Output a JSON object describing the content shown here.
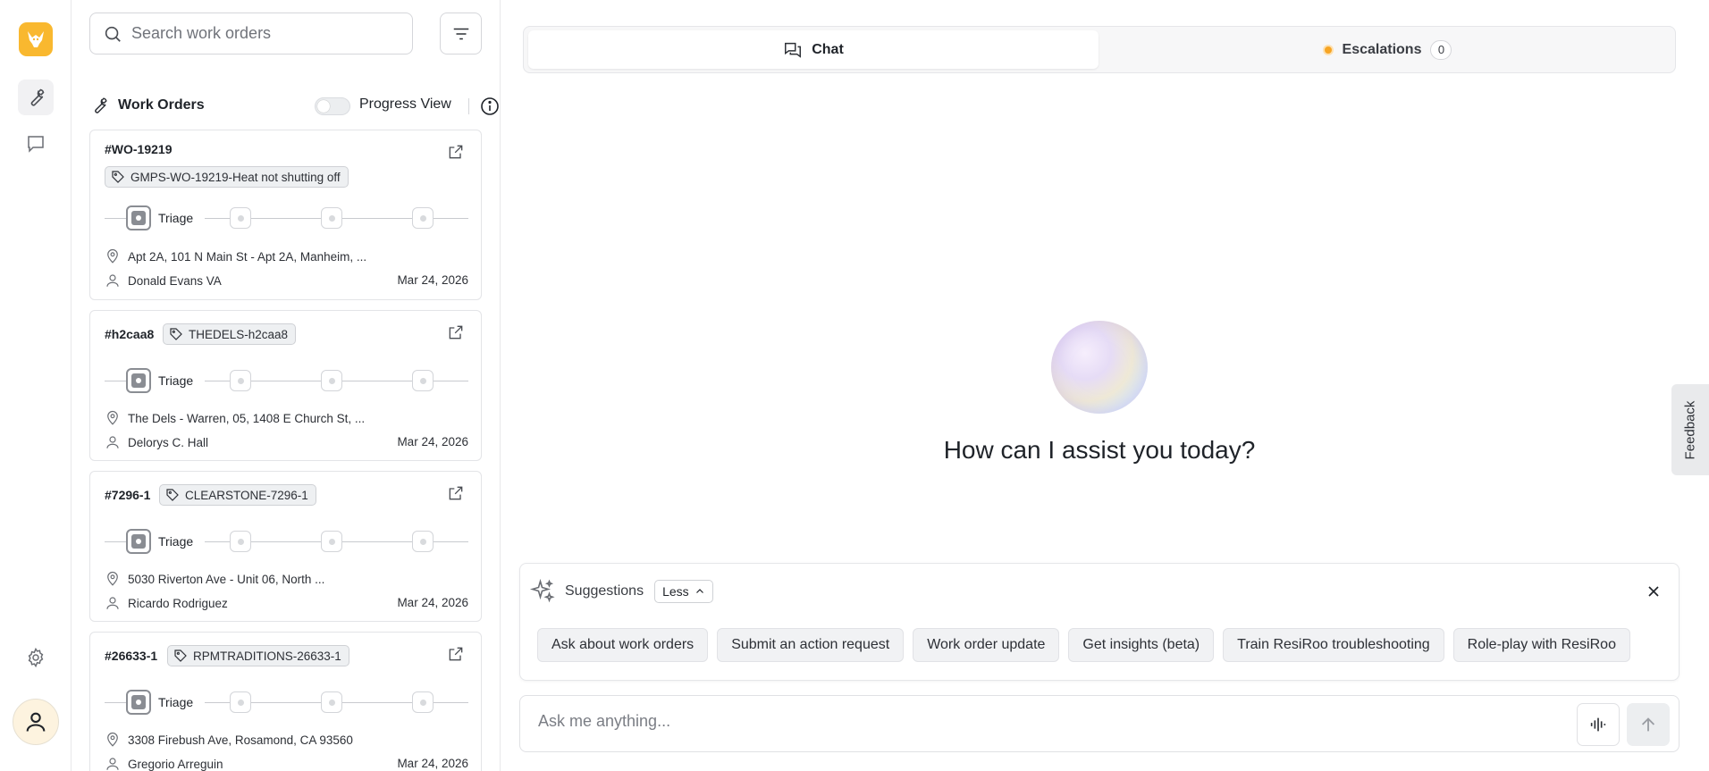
{
  "rail": {
    "logo_color": "#f9b82f",
    "items": [
      {
        "icon": "wrench-icon",
        "active": true
      },
      {
        "icon": "chat-bubble-icon",
        "active": false
      }
    ],
    "settings_icon": "gear-icon",
    "avatar_icon": "user-icon"
  },
  "workorders": {
    "search_placeholder": "Search work orders",
    "header_title": "Work Orders",
    "progress_view_label": "Progress View",
    "progress_view_on": false,
    "cards": [
      {
        "id": "#WO-19219",
        "tag": "GMPS-WO-19219-Heat not shutting off",
        "stage": "Triage",
        "address": "Apt 2A, 101 N Main St - Apt 2A, Manheim, ...",
        "person": "Donald Evans VA",
        "date": "Mar 24, 2026"
      },
      {
        "id": "#h2caa8",
        "tag": "THEDELS-h2caa8",
        "stage": "Triage",
        "address": "The Dels - Warren, 05, 1408 E Church St, ...",
        "person": "Delorys C. Hall",
        "date": "Mar 24, 2026"
      },
      {
        "id": "#7296-1",
        "tag": "CLEARSTONE-7296-1",
        "stage": "Triage",
        "address": "5030 Riverton Ave - Unit 06, North ...",
        "person": "Ricardo Rodriguez",
        "date": "Mar 24, 2026"
      },
      {
        "id": "#26633-1",
        "tag": "RPMTRADITIONS-26633-1",
        "stage": "Triage",
        "address": "3308 Firebush Ave, Rosamond, CA 93560",
        "person": "Gregorio Arreguin",
        "date": "Mar 24, 2026"
      }
    ]
  },
  "tabs": {
    "chat_label": "Chat",
    "escalations_label": "Escalations",
    "escalations_count": "0",
    "escalation_dot_color": "#f7a524"
  },
  "main": {
    "greeting": "How can I assist you today?"
  },
  "feedback_label": "Feedback",
  "suggestions": {
    "title": "Suggestions",
    "toggle_label": "Less",
    "chips": [
      "Ask about work orders",
      "Submit an action request",
      "Work order update",
      "Get insights (beta)",
      "Train ResiRoo troubleshooting",
      "Role-play with ResiRoo"
    ]
  },
  "composer": {
    "placeholder": "Ask me anything..."
  }
}
